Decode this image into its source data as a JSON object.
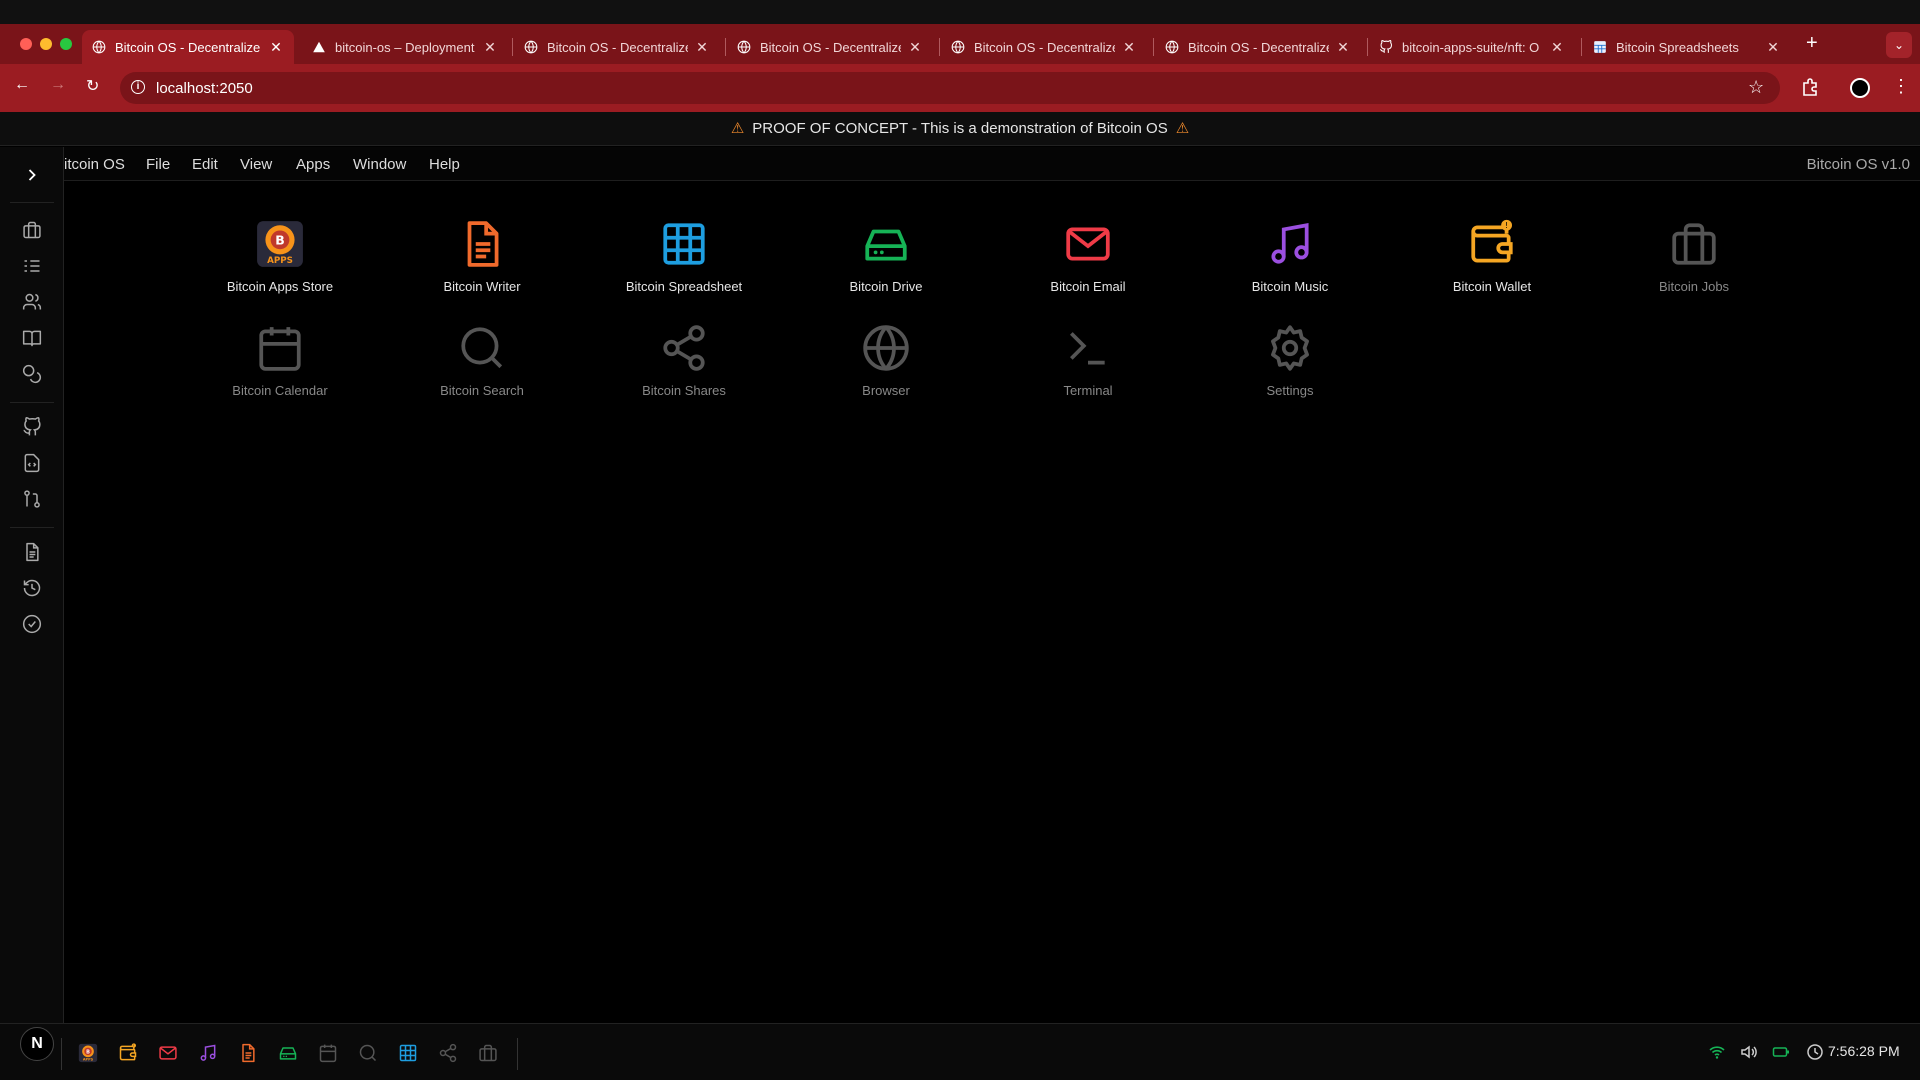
{
  "browser": {
    "tabs": [
      {
        "title": "Bitcoin OS - Decentralize",
        "icon": "globe-icon",
        "active": true
      },
      {
        "title": "bitcoin-os – Deployment",
        "icon": "vercel-icon",
        "active": false
      },
      {
        "title": "Bitcoin OS - Decentralize",
        "icon": "globe-icon",
        "active": false
      },
      {
        "title": "Bitcoin OS - Decentralize",
        "icon": "globe-icon",
        "active": false
      },
      {
        "title": "Bitcoin OS - Decentralize",
        "icon": "globe-icon",
        "active": false
      },
      {
        "title": "Bitcoin OS - Decentralize",
        "icon": "globe-icon",
        "active": false
      },
      {
        "title": "bitcoin-apps-suite/nft: O",
        "icon": "github-icon",
        "active": false
      },
      {
        "title": "Bitcoin Spreadsheets",
        "icon": "spreadsheet-favicon",
        "active": false
      }
    ],
    "url": "localhost:2050",
    "theme_color": "#9b1c22"
  },
  "banner": {
    "text": "PROOF OF CONCEPT - This is a demonstration of Bitcoin OS"
  },
  "menubar": {
    "items": [
      "itcoin OS",
      "File",
      "Edit",
      "View",
      "Apps",
      "Window",
      "Help"
    ],
    "version": "Bitcoin OS v1.0"
  },
  "desktop": {
    "apps": [
      {
        "label": "Bitcoin Apps Store",
        "icon": "apps-store-logo",
        "color": "#f7931a",
        "dim": false
      },
      {
        "label": "Bitcoin Writer",
        "icon": "document-icon",
        "color": "#f06a2c",
        "dim": false
      },
      {
        "label": "Bitcoin Spreadsheet",
        "icon": "table-icon",
        "color": "#1e9ee0",
        "dim": false
      },
      {
        "label": "Bitcoin Drive",
        "icon": "drive-icon",
        "color": "#16b356",
        "dim": false
      },
      {
        "label": "Bitcoin Email",
        "icon": "mail-icon",
        "color": "#ef3b47",
        "dim": false
      },
      {
        "label": "Bitcoin Music",
        "icon": "music-icon",
        "color": "#9b4fe0",
        "dim": false
      },
      {
        "label": "Bitcoin Wallet",
        "icon": "wallet-icon",
        "color": "#f5a623",
        "dim": false
      },
      {
        "label": "Bitcoin Jobs",
        "icon": "briefcase-icon",
        "color": "#555555",
        "dim": true
      },
      {
        "label": "Bitcoin Calendar",
        "icon": "calendar-icon",
        "color": "#555555",
        "dim": true
      },
      {
        "label": "Bitcoin Search",
        "icon": "search-icon",
        "color": "#555555",
        "dim": true
      },
      {
        "label": "Bitcoin Shares",
        "icon": "share-icon",
        "color": "#555555",
        "dim": true
      },
      {
        "label": "Browser",
        "icon": "globe-icon",
        "color": "#555555",
        "dim": true
      },
      {
        "label": "Terminal",
        "icon": "terminal-icon",
        "color": "#555555",
        "dim": true
      },
      {
        "label": "Settings",
        "icon": "gear-icon",
        "color": "#555555",
        "dim": true
      }
    ]
  },
  "sidebar": {
    "icons": [
      "chevron-right-icon",
      "briefcase-icon",
      "task-list-icon",
      "users-icon",
      "book-icon",
      "coins-icon",
      "github-icon",
      "code-file-icon",
      "git-pull-request-icon",
      "document-icon",
      "history-icon",
      "check-circle-icon"
    ]
  },
  "dock": {
    "badge": "N",
    "apps": [
      "apps-store-logo",
      "wallet-icon",
      "mail-icon",
      "music-icon",
      "document-icon",
      "drive-icon",
      "calendar-icon",
      "search-icon",
      "table-icon",
      "share-icon",
      "briefcase-icon"
    ],
    "clock": "7:56:28 PM"
  }
}
